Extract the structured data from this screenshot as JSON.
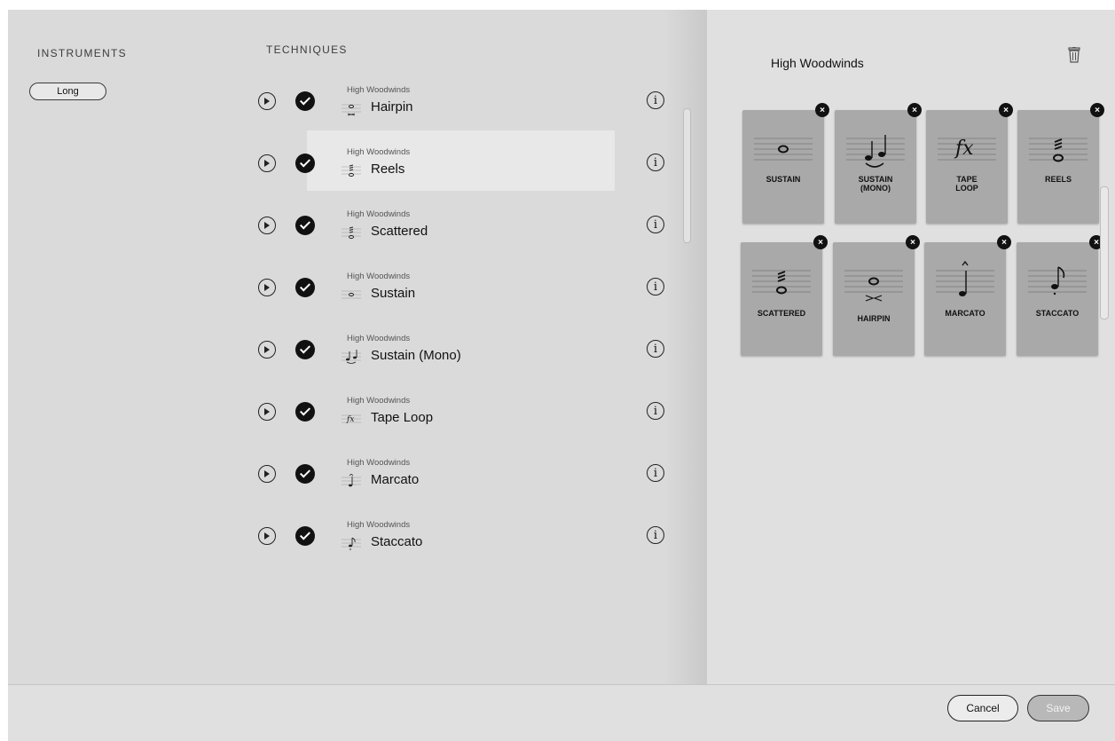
{
  "instruments": {
    "title": "INSTRUMENTS",
    "selected": "Long"
  },
  "techniques": {
    "title": "TECHNIQUES",
    "items": [
      {
        "group": "High Woodwinds",
        "name": "Hairpin"
      },
      {
        "group": "High Woodwinds",
        "name": "Reels"
      },
      {
        "group": "High Woodwinds",
        "name": "Scattered"
      },
      {
        "group": "High Woodwinds",
        "name": "Sustain"
      },
      {
        "group": "High Woodwinds",
        "name": "Sustain (Mono)"
      },
      {
        "group": "High Woodwinds",
        "name": "Tape Loop"
      },
      {
        "group": "High Woodwinds",
        "name": "Marcato"
      },
      {
        "group": "High Woodwinds",
        "name": "Staccato"
      }
    ]
  },
  "panel": {
    "title": "High Woodwinds",
    "cards": [
      {
        "label": "SUSTAIN",
        "icon": "whole-note-icon"
      },
      {
        "label": "SUSTAIN\n(MONO)",
        "icon": "slurred-notes-icon"
      },
      {
        "label": "TAPE\nLOOP",
        "icon": "fx-icon"
      },
      {
        "label": "REELS",
        "icon": "tremolo-note-icon"
      },
      {
        "label": "SCATTERED",
        "icon": "tremolo-note-icon"
      },
      {
        "label": "HAIRPIN",
        "icon": "hairpin-note-icon"
      },
      {
        "label": "MARCATO",
        "icon": "marcato-note-icon"
      },
      {
        "label": "STACCATO",
        "icon": "staccato-note-icon"
      }
    ]
  },
  "footer": {
    "cancel": "Cancel",
    "save": "Save"
  }
}
